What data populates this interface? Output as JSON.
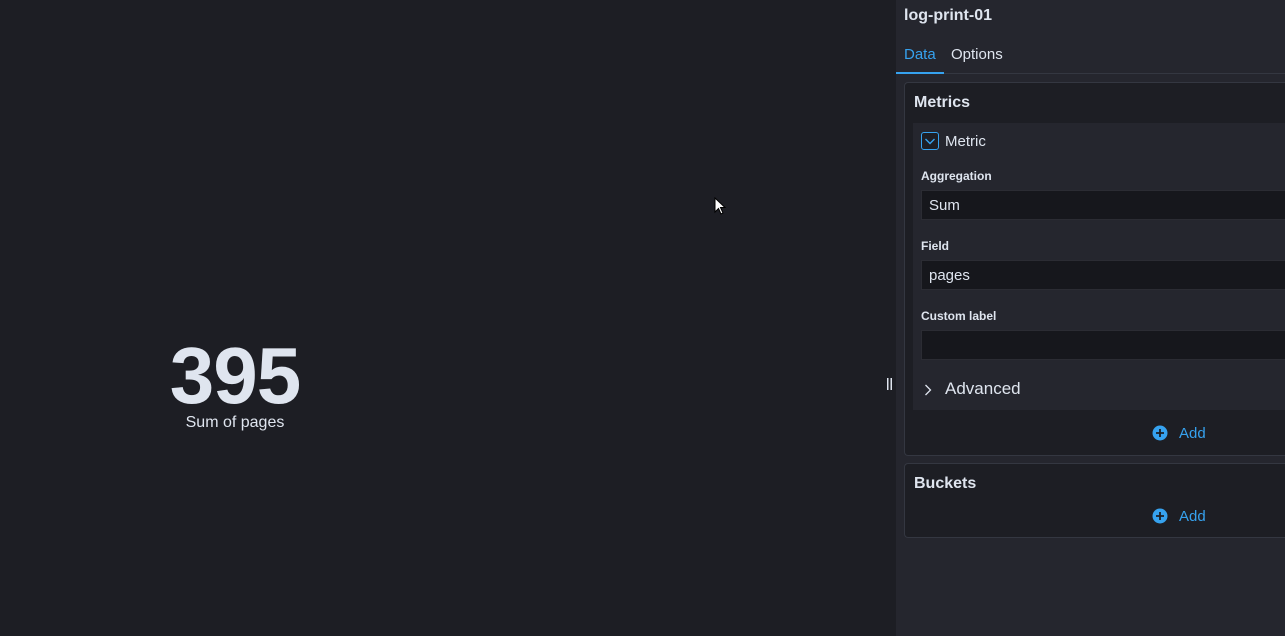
{
  "visualization": {
    "metric_value": "395",
    "metric_label": "Sum of pages"
  },
  "sidebar": {
    "title": "log-print-01",
    "tabs": [
      {
        "label": "Data",
        "active": true
      },
      {
        "label": "Options",
        "active": false
      }
    ],
    "metrics": {
      "title": "Metrics",
      "aggregation_item": {
        "name": "Metric",
        "expanded": true,
        "aggregation_label": "Aggregation",
        "aggregation_value": "Sum",
        "field_label": "Field",
        "field_value": "pages",
        "custom_label_label": "Custom label",
        "custom_label_value": "",
        "advanced_label": "Advanced"
      },
      "add_label": "Add"
    },
    "buckets": {
      "title": "Buckets",
      "add_label": "Add"
    }
  },
  "colors": {
    "accent": "#36a2ef",
    "background": "#1d1e24",
    "sidebar_background": "#25262e",
    "text": "#dfe5ef"
  },
  "icons": {
    "cursor": "mouse-pointer-icon",
    "collapse_toggle": "chevron-down-icon",
    "advanced_toggle": "chevron-right-icon",
    "add": "plus-circle-icon",
    "resize": "resize-handle-icon"
  }
}
